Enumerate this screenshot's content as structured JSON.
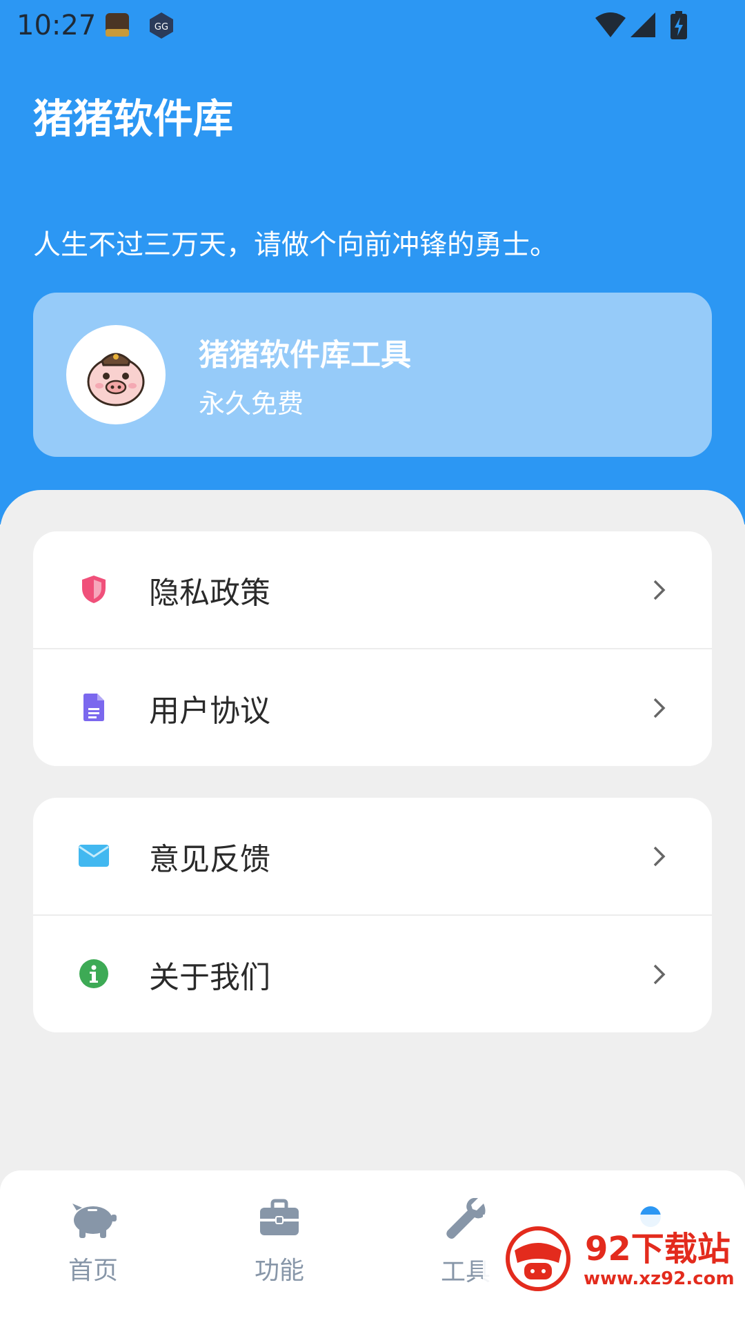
{
  "status_bar": {
    "time": "10:27"
  },
  "header": {
    "title": "猪猪软件库",
    "slogan": "人生不过三万天，请做个向前冲锋的勇士。"
  },
  "profile_card": {
    "title": "猪猪软件库工具",
    "subtitle": "永久免费"
  },
  "menu_groups": [
    {
      "items": [
        {
          "label": "隐私政策",
          "icon": "shield-icon",
          "color": "#f0507a"
        },
        {
          "label": "用户协议",
          "icon": "document-icon",
          "color": "#7b68ee"
        }
      ]
    },
    {
      "items": [
        {
          "label": "意见反馈",
          "icon": "mail-icon",
          "color": "#42b8f0"
        },
        {
          "label": "关于我们",
          "icon": "info-icon",
          "color": "#3daa55"
        }
      ]
    }
  ],
  "bottom_nav": {
    "items": [
      {
        "label": "首页",
        "icon": "piggy-bank-icon"
      },
      {
        "label": "功能",
        "icon": "toolbox-icon"
      },
      {
        "label": "工具",
        "icon": "wrench-icon"
      }
    ],
    "active_color": "#2c97f3"
  },
  "watermark": {
    "name": "92下载站",
    "url": "www.xz92.com"
  },
  "colors": {
    "primary": "#2c97f3",
    "background": "#efefef"
  }
}
